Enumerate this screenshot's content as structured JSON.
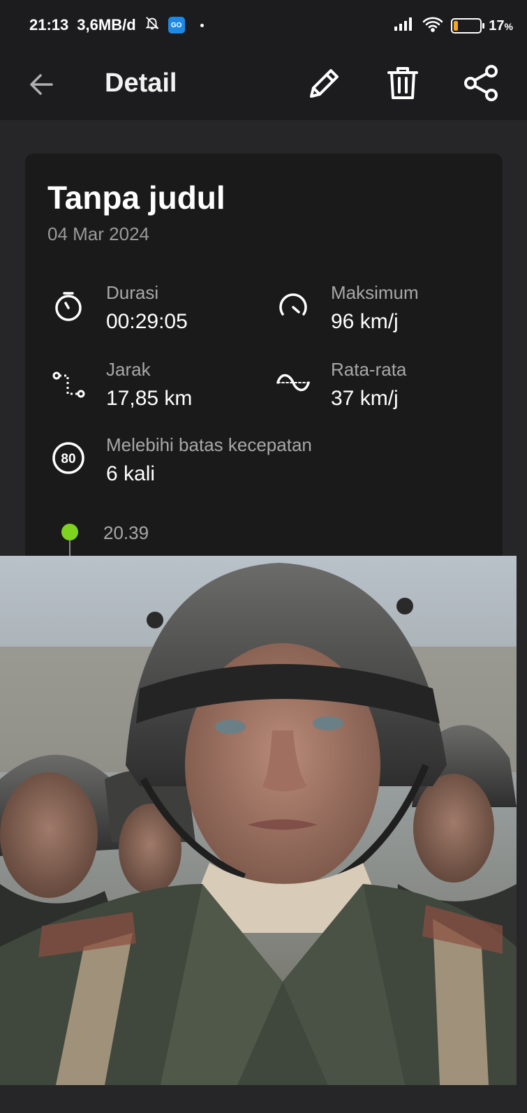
{
  "status_bar": {
    "time": "21:13",
    "data_rate": "3,6MB/d",
    "badge": "GO",
    "battery": "17",
    "battery_unit": "%",
    "battery_level": 0.17
  },
  "app_bar": {
    "title": "Detail",
    "back_icon": "arrow-left-icon",
    "edit_icon": "pencil-icon",
    "delete_icon": "trash-icon",
    "share_icon": "share-icon"
  },
  "trip": {
    "title": "Tanpa judul",
    "date": "04 Mar 2024",
    "stats": {
      "duration": {
        "label": "Durasi",
        "value": "00:29:05",
        "icon": "stopwatch-icon"
      },
      "max_speed": {
        "label": "Maksimum",
        "value": "96 km/j",
        "icon": "speedometer-icon"
      },
      "distance": {
        "label": "Jarak",
        "value": "17,85 km",
        "icon": "route-icon"
      },
      "avg_speed": {
        "label": "Rata-rata",
        "value": "37 km/j",
        "icon": "wave-icon"
      },
      "over_limit": {
        "label": "Melebihi batas kecepatan",
        "value": "6 kali",
        "icon": "speed-limit-icon",
        "badge": "80"
      }
    },
    "timeline": {
      "start_time": "20.39",
      "start_color": "#7ed321"
    }
  },
  "colors": {
    "background": "#262628",
    "app_bar": "#1c1c1e",
    "card": "#1a1a1a",
    "accent_green": "#7ed321"
  }
}
